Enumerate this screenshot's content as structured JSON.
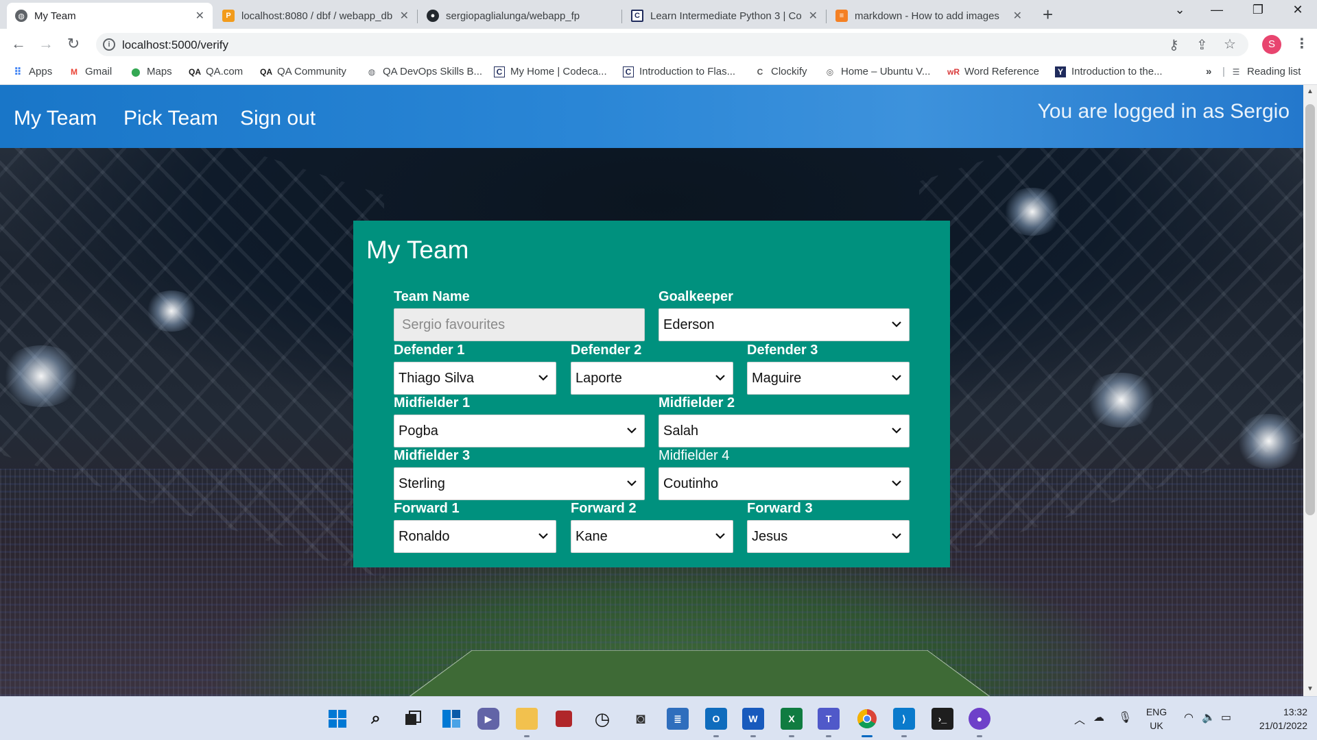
{
  "browser": {
    "tabs": [
      {
        "title": "My Team",
        "icon": "globe-icon",
        "active": true
      },
      {
        "title": "localhost:8080 / dbf / webapp_db",
        "icon": "phpmyadmin-icon"
      },
      {
        "title": "sergiopaglialunga/webapp_fp",
        "icon": "github-icon"
      },
      {
        "title": "Learn Intermediate Python 3 | Co",
        "icon": "codecademy-icon"
      },
      {
        "title": "markdown - How to add images",
        "icon": "stackoverflow-icon"
      }
    ],
    "url": "localhost:5000/verify",
    "profile_initial": "S",
    "bookmarks": [
      {
        "label": "Apps",
        "icon": "apps-grid-icon"
      },
      {
        "label": "Gmail",
        "icon": "gmail-icon"
      },
      {
        "label": "Maps",
        "icon": "maps-icon"
      },
      {
        "label": "QA.com",
        "icon": "qa-icon"
      },
      {
        "label": "QA Community",
        "icon": "qa-icon"
      },
      {
        "label": "QA DevOps Skills B...",
        "icon": "globe-icon"
      },
      {
        "label": "My Home | Codeca...",
        "icon": "codecademy-icon"
      },
      {
        "label": "Introduction to Flas...",
        "icon": "codecademy-icon"
      },
      {
        "label": "Clockify",
        "icon": "clockify-icon"
      },
      {
        "label": "Home – Ubuntu V...",
        "icon": "ubuntu-icon"
      },
      {
        "label": "Word Reference",
        "icon": "wordreference-icon"
      },
      {
        "label": "Introduction to the...",
        "icon": "yc-icon"
      }
    ],
    "overflow": "»",
    "reading_list": "Reading list"
  },
  "site": {
    "nav": [
      "My Team",
      "Pick Team",
      "Sign out"
    ],
    "logged_in": "You are logged in as Sergio"
  },
  "form": {
    "title": "My Team",
    "team_name": {
      "label": "Team Name",
      "value": "Sergio favourites"
    },
    "goalkeeper": {
      "label": "Goalkeeper",
      "value": "Ederson"
    },
    "defenders": [
      {
        "label": "Defender 1",
        "value": "Thiago Silva"
      },
      {
        "label": "Defender 2",
        "value": "Laporte"
      },
      {
        "label": "Defender 3",
        "value": "Maguire"
      }
    ],
    "midfielders": [
      {
        "label": "Midfielder 1",
        "value": "Pogba"
      },
      {
        "label": "Midfielder 2",
        "value": "Salah"
      },
      {
        "label": "Midfielder 3",
        "value": "Sterling"
      },
      {
        "label": "Midfielder 4",
        "value": "Coutinho"
      }
    ],
    "forwards": [
      {
        "label": "Forward 1",
        "value": "Ronaldo"
      },
      {
        "label": "Forward 2",
        "value": "Kane"
      },
      {
        "label": "Forward 3",
        "value": "Jesus"
      }
    ]
  },
  "taskbar": {
    "apps": [
      "start-icon",
      "search-icon",
      "task-view-icon",
      "widgets-icon",
      "teams-chat-icon",
      "file-explorer-icon",
      "app-red-icon",
      "clock-icon",
      "camera-icon",
      "notepad-icon",
      "outlook-icon",
      "word-icon",
      "excel-icon",
      "teams-icon",
      "chrome-icon",
      "vscode-icon",
      "terminal-icon",
      "github-desktop-icon"
    ],
    "lang": "ENG",
    "region": "UK",
    "time": "13:32",
    "date": "21/01/2022"
  },
  "colors": {
    "navbar": "#1976c8",
    "card": "#00917e",
    "profile": "#e8456f"
  }
}
